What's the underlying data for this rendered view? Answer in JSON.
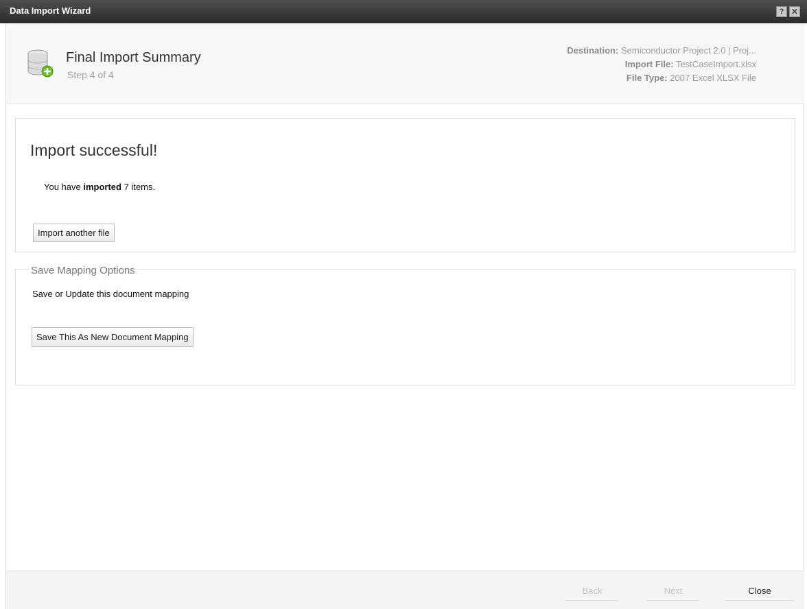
{
  "window": {
    "title": "Data Import Wizard",
    "help_glyph": "?",
    "close_glyph": "✕"
  },
  "header": {
    "title": "Final Import Summary",
    "step": "Step 4 of 4",
    "destination_label": "Destination:",
    "destination_value": "Semiconductor Project 2.0 | Proj...",
    "import_file_label": "Import File:",
    "import_file_value": "TestCaseImport.xlsx",
    "file_type_label": "File Type:",
    "file_type_value": "2007 Excel XLSX File"
  },
  "success": {
    "heading": "Import successful!",
    "msg_prefix": "You have ",
    "msg_bold": "imported",
    "msg_suffix": " 7 items.",
    "import_another_label": "Import another file"
  },
  "mapping": {
    "legend": "Save Mapping Options",
    "description": "Save or Update this document mapping",
    "save_button_label": "Save This As New Document Mapping"
  },
  "footer": {
    "back_label": "Back",
    "next_label": "Next",
    "close_label": "Close"
  },
  "icons": {
    "database": "database-add-icon"
  }
}
